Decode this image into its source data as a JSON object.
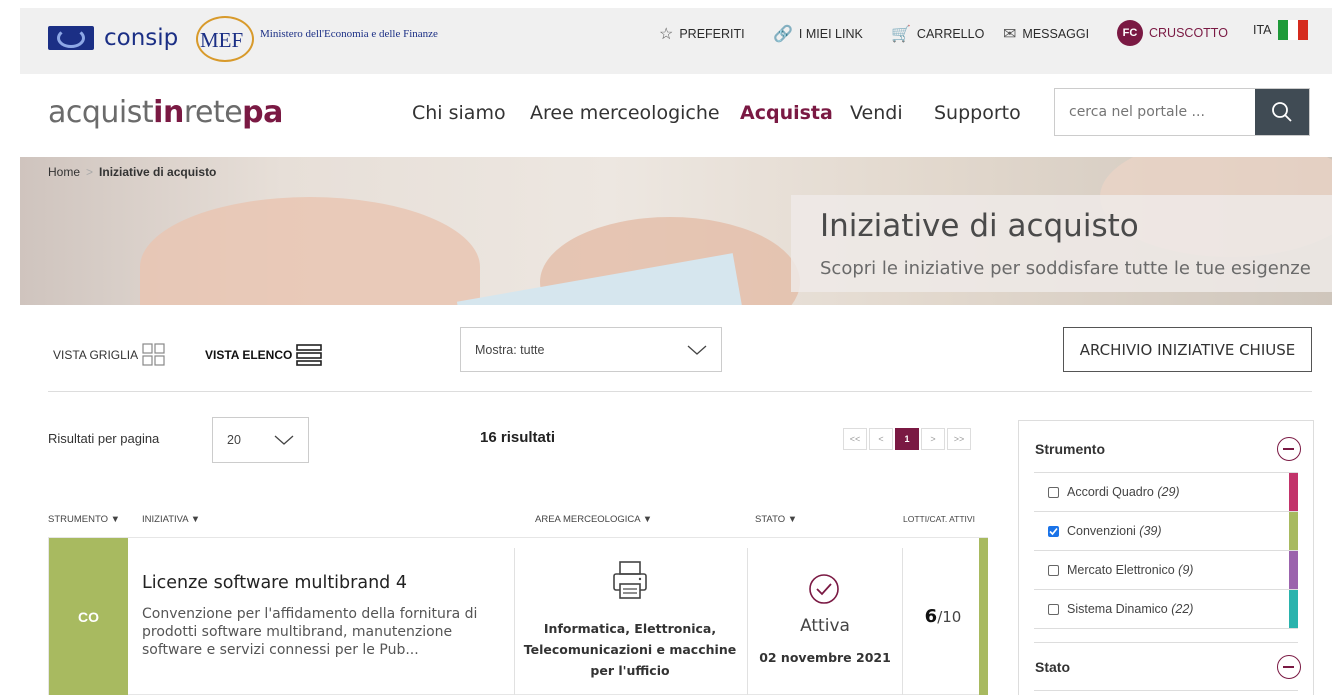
{
  "topbar": {
    "consip_text": "consip",
    "mef_text": "MEF",
    "mef_sub": "Ministero dell'Economia e delle Finanze",
    "links": [
      {
        "label": "PREFERITI",
        "icon": "star-icon"
      },
      {
        "label": "I MIEI LINK",
        "icon": "link-icon"
      },
      {
        "label": "CARRELLO",
        "icon": "cart-icon"
      },
      {
        "label": "MESSAGGI",
        "icon": "mail-icon"
      },
      {
        "label": "CRUSCOTTO",
        "icon": "user-badge"
      }
    ],
    "user_initials": "FC",
    "language": "ITA",
    "flag_colors": [
      "#1f9a3a",
      "#ffffff",
      "#d52b1e"
    ]
  },
  "header": {
    "brand_plain1": "acquist",
    "brand_bold1": "in",
    "brand_plain2": "rete",
    "brand_bold2": "pa",
    "nav": [
      "Chi siamo",
      "Aree merceologiche",
      "Acquista",
      "Vendi",
      "Supporto"
    ],
    "active_nav": "Acquista",
    "search_placeholder": "cerca nel portale ..."
  },
  "breadcrumb": {
    "home": "Home",
    "current": "Iniziative di acquisto"
  },
  "hero": {
    "title": "Iniziative di acquisto",
    "subtitle": "Scopri le iniziative per soddisfare tutte le tue esigenze"
  },
  "controls": {
    "vista_griglia": "VISTA GRIGLIA",
    "vista_elenco": "VISTA ELENCO",
    "mostra": "Mostra: tutte",
    "archive_button": "ARCHIVIO INIZIATIVE CHIUSE",
    "rpp_label": "Risultati per pagina",
    "rpp_value": "20",
    "results_count": "16 risultati",
    "pager": [
      "<<",
      "<",
      "1",
      ">",
      ">>"
    ],
    "current_page": "1"
  },
  "table": {
    "headers": {
      "strumento": "STRUMENTO ▼",
      "iniziativa": "INIZIATIVA ▼",
      "area": "AREA MERCEOLOGICA ▼",
      "stato": "STATO ▼",
      "lotti": "LOTTI/CAT. ATTIVI"
    },
    "rows": [
      {
        "tag": "CO",
        "title": "Licenze software multibrand 4",
        "description": "Convenzione per l'affidamento della fornitura di prodotti software multibrand, manutenzione software e servizi connessi per le Pub...",
        "area": "Informatica, Elettronica, Telecomunicazioni e macchine per l'ufficio",
        "stato": "Attiva",
        "date": "02 novembre 2021",
        "lotti_active": "6",
        "lotti_total": "/10",
        "color": "#a8ba60"
      }
    ]
  },
  "filters": {
    "strumento_title": "Strumento",
    "stato_title": "Stato",
    "items": [
      {
        "label": "Accordi Quadro",
        "count": "(29)",
        "checked": false,
        "color": "#c2336a"
      },
      {
        "label": "Convenzioni",
        "count": "(39)",
        "checked": true,
        "color": "#a8ba60"
      },
      {
        "label": "Mercato Elettronico",
        "count": "(9)",
        "checked": false,
        "color": "#9b63ad"
      },
      {
        "label": "Sistema Dinamico",
        "count": "(22)",
        "checked": false,
        "color": "#2ab3ad"
      }
    ]
  }
}
